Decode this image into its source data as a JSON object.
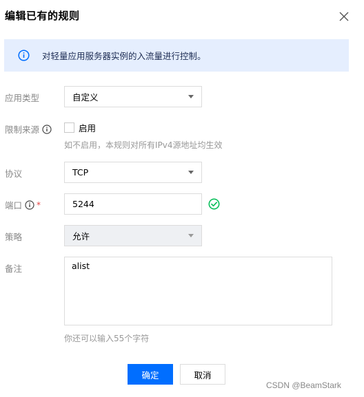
{
  "dialog": {
    "title": "编辑已有的规则"
  },
  "notice": {
    "text": "对轻量应用服务器实例的入流量进行控制。"
  },
  "form": {
    "app_type": {
      "label": "应用类型",
      "value": "自定义"
    },
    "source_limit": {
      "label": "限制来源",
      "checkbox_label": "启用",
      "checked": false,
      "hint": "如不启用，本规则对所有IPv4源地址均生效"
    },
    "protocol": {
      "label": "协议",
      "value": "TCP"
    },
    "port": {
      "label": "端口",
      "required_mark": "*",
      "value": "5244"
    },
    "policy": {
      "label": "策略",
      "value": "允许"
    },
    "remark": {
      "label": "备注",
      "value": "alist",
      "hint": "你还可以输入55个字符"
    }
  },
  "buttons": {
    "confirm": "确定",
    "cancel": "取消"
  },
  "watermark": "CSDN @BeamStark",
  "colors": {
    "primary": "#006eff",
    "notice_bg": "#e5eefe",
    "success": "#0abf5b",
    "required": "#e54545"
  },
  "icons": {
    "close": "close-icon",
    "info": "info-icon",
    "help": "help-icon",
    "success": "check-circle-icon",
    "caret": "caret-down-icon"
  }
}
